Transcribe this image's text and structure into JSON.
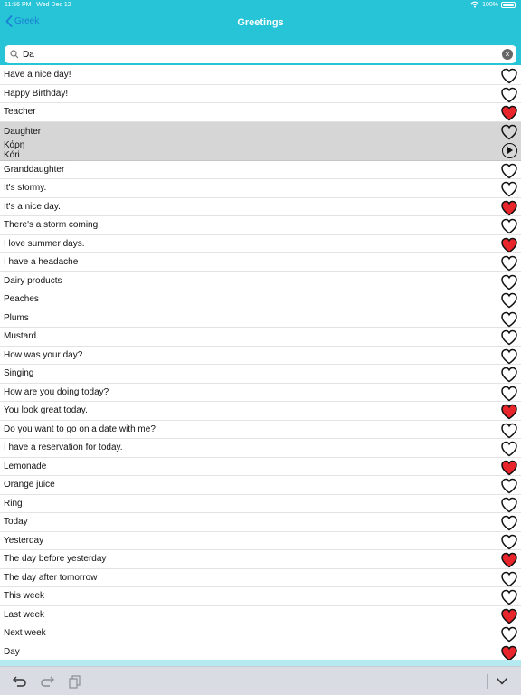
{
  "status": {
    "time": "11:56 PM",
    "date": "Wed Dec 12",
    "battery": "100%"
  },
  "nav": {
    "back_label": "Greek",
    "title": "Greetings"
  },
  "search": {
    "value": "Da"
  },
  "colors": {
    "accent": "#27c3d6",
    "back_link": "#1a7fd4",
    "favorite": "#e8252b",
    "selected_row": "#d6d6d6"
  },
  "selected": {
    "index": 3,
    "translation": "Κόρη",
    "transliteration": "Kóri"
  },
  "phrases": [
    {
      "text": "Have a nice day!",
      "favorite": false
    },
    {
      "text": "Happy Birthday!",
      "favorite": false
    },
    {
      "text": "Teacher",
      "favorite": true
    },
    {
      "text": "Daughter",
      "favorite": false
    },
    {
      "text": "Granddaughter",
      "favorite": false
    },
    {
      "text": "It's stormy.",
      "favorite": false
    },
    {
      "text": "It's a nice day.",
      "favorite": true
    },
    {
      "text": "There's a storm coming.",
      "favorite": false
    },
    {
      "text": "I love summer days.",
      "favorite": true
    },
    {
      "text": "I have a headache",
      "favorite": false
    },
    {
      "text": "Dairy products",
      "favorite": false
    },
    {
      "text": "Peaches",
      "favorite": false
    },
    {
      "text": "Plums",
      "favorite": false
    },
    {
      "text": "Mustard",
      "favorite": false
    },
    {
      "text": "How was your day?",
      "favorite": false
    },
    {
      "text": "Singing",
      "favorite": false
    },
    {
      "text": "How are you doing today?",
      "favorite": false
    },
    {
      "text": "You look great today.",
      "favorite": true
    },
    {
      "text": "Do you want to go on a date with me?",
      "favorite": false
    },
    {
      "text": "I have a reservation for today.",
      "favorite": false
    },
    {
      "text": "Lemonade",
      "favorite": true
    },
    {
      "text": "Orange juice",
      "favorite": false
    },
    {
      "text": "Ring",
      "favorite": false
    },
    {
      "text": "Today",
      "favorite": false
    },
    {
      "text": "Yesterday",
      "favorite": false
    },
    {
      "text": "The day before yesterday",
      "favorite": true
    },
    {
      "text": "The day after tomorrow",
      "favorite": false
    },
    {
      "text": "This week",
      "favorite": false
    },
    {
      "text": "Last week",
      "favorite": true
    },
    {
      "text": "Next week",
      "favorite": false
    },
    {
      "text": "Day",
      "favorite": true
    }
  ],
  "icons": {
    "back": "chevron-left-icon",
    "search": "search-icon",
    "clear": "clear-icon",
    "favorite": "heart-icon",
    "play": "play-icon",
    "undo": "undo-icon",
    "redo": "redo-icon",
    "paste": "paste-icon",
    "dismiss_keyboard": "chevron-down-icon"
  }
}
